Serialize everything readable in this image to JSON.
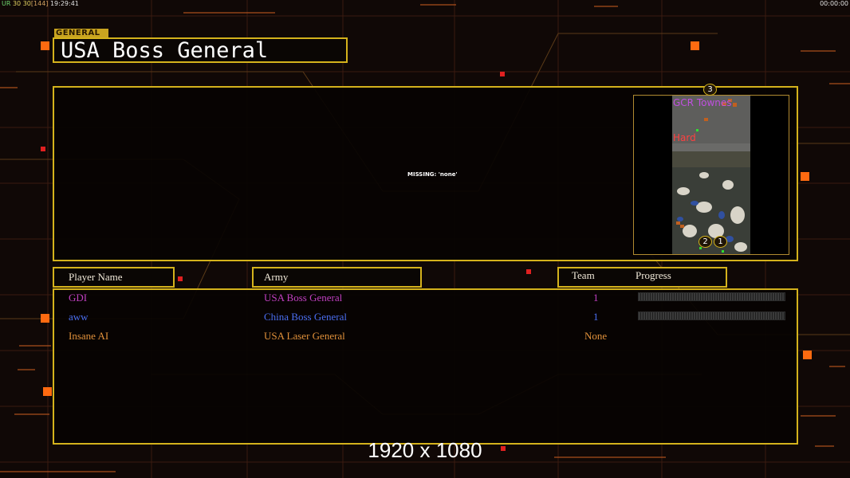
{
  "hud": {
    "top_left_tag": "UR",
    "top_left_n1": "30",
    "top_left_n2": "30",
    "top_left_bracket": "[144]",
    "top_left_time": "19:29:41",
    "top_right_time": "00:00:00"
  },
  "header": {
    "category_label": "GENERAL",
    "title": "USA Boss General"
  },
  "preview": {
    "missing_text": "MISSING: 'none'"
  },
  "map": {
    "name": "GCR Townes",
    "difficulty": "Hard",
    "markers": [
      "3",
      "2",
      "1"
    ]
  },
  "columns": {
    "player_name": "Player Name",
    "army": "Army",
    "team": "Team",
    "progress": "Progress"
  },
  "players": [
    {
      "name": "GDI",
      "army": "USA Boss General",
      "team": "1",
      "color": "#c040c0",
      "progress": 0
    },
    {
      "name": "aww",
      "army": "China Boss General",
      "team": "1",
      "color": "#4a6ef0",
      "progress": 0
    },
    {
      "name": "Insane AI",
      "army": "USA Laser General",
      "team": "None",
      "color": "#e0903a",
      "progress": null
    }
  ],
  "footer": {
    "resolution": "1920 x 1080"
  }
}
